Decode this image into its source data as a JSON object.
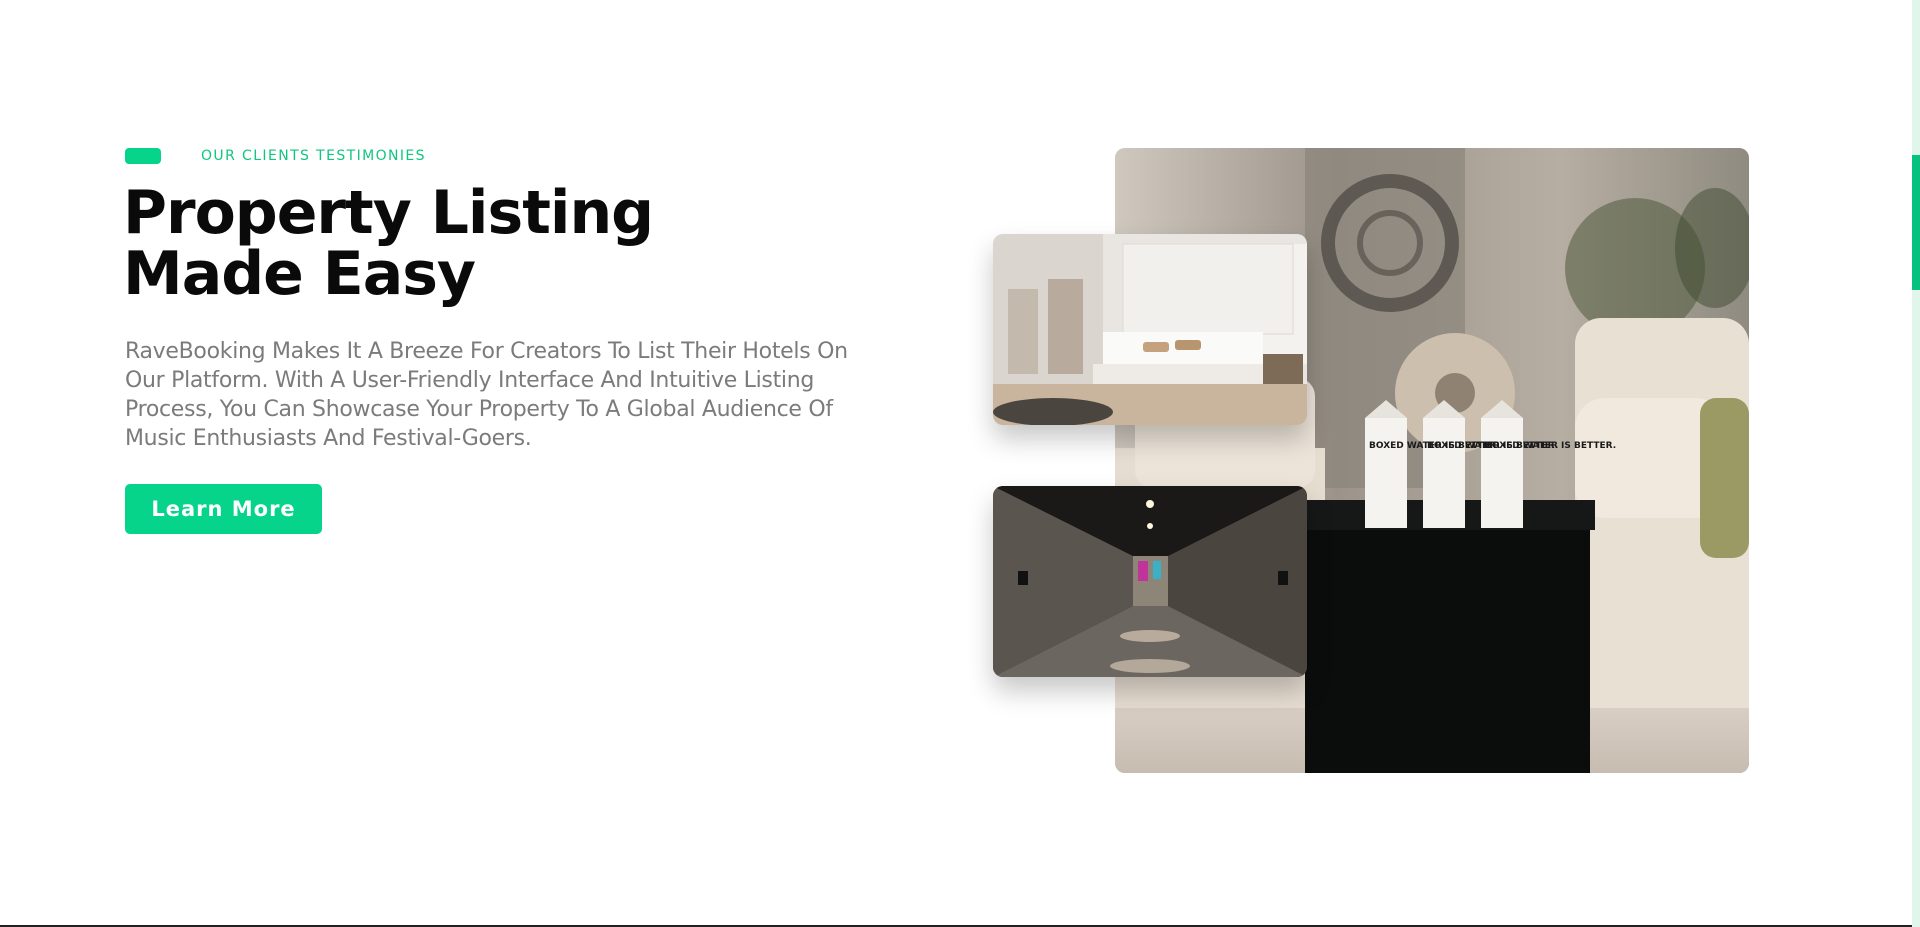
{
  "hero": {
    "eyebrow": "OUR CLIENTS TESTIMONIES",
    "headline_line1": "Property Listing",
    "headline_line2": "Made Easy",
    "description": "RaveBooking Makes It A Breeze For Creators To List Their Hotels On Our Platform. With A User-Friendly Interface And Intuitive Listing Process, You Can Showcase Your Property To A Global Audience Of Music Enthusiasts And Festival-Goers.",
    "cta_label": "Learn More"
  },
  "gallery": {
    "box_text": "BOXED WATER IS BETTER."
  },
  "colors": {
    "accent": "#05d48a",
    "headline": "#0a0a0a",
    "body_text": "#7b7b7b"
  },
  "icons": {
    "eyebrow_marker": "green-pill"
  }
}
